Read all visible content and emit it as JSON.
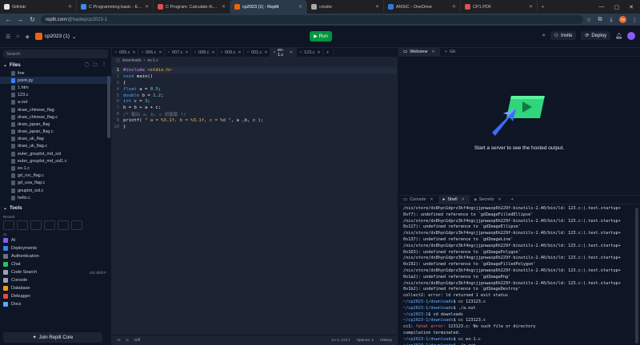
{
  "browser": {
    "tabs": [
      {
        "label": "GitHub",
        "color": "#e6e6e6",
        "active": false
      },
      {
        "label": "C Programming basic - Exerc",
        "color": "#4285f4",
        "active": false
      },
      {
        "label": "C Program: Calculate the sur",
        "color": "#d9534f",
        "active": false
      },
      {
        "label": "cp2023 (1) - Replit",
        "color": "#f26207",
        "active": true
      },
      {
        "label": "cmsite",
        "color": "#aaaaaa",
        "active": false
      },
      {
        "label": "ANSIC - OneDrive",
        "color": "#2c7cd1",
        "active": false
      },
      {
        "label": "CP1.PDF",
        "color": "#d9534f",
        "active": false
      }
    ],
    "url_host": "replit.com",
    "url_path": "/@hadoq/cp2023-1",
    "profile_initials": "hs"
  },
  "app": {
    "repl_name": "cp2023 (1)",
    "run_label": "Run",
    "invite_label": "Invite",
    "deploy_label": "Deploy"
  },
  "sidebar": {
    "search_placeholder": "Search",
    "files_title": "Files",
    "files": [
      {
        "name": "line",
        "kind": "file"
      },
      {
        "name": "point.py",
        "kind": "py"
      },
      {
        "name": "1.htm",
        "kind": "file"
      },
      {
        "name": "123.c",
        "kind": "file"
      },
      {
        "name": "a.out",
        "kind": "file"
      },
      {
        "name": "draw_chinese_flag",
        "kind": "file"
      },
      {
        "name": "draw_chinese_flag.c",
        "kind": "file"
      },
      {
        "name": "draw_japan_flag",
        "kind": "file"
      },
      {
        "name": "draw_japan_flag.c",
        "kind": "file"
      },
      {
        "name": "draw_uk_flag",
        "kind": "file"
      },
      {
        "name": "draw_uk_flag.c",
        "kind": "file"
      },
      {
        "name": "euler_gnuplot_md_sol",
        "kind": "file"
      },
      {
        "name": "euler_gnuplot_md_sol1.c",
        "kind": "file"
      },
      {
        "name": "ex-1.c",
        "kind": "file"
      },
      {
        "name": "gd_roc_flag.c",
        "kind": "file"
      },
      {
        "name": "gd_usa_flag.c",
        "kind": "file"
      },
      {
        "name": "gnuplot_sol.c",
        "kind": "file"
      },
      {
        "name": "hello.c",
        "kind": "file"
      }
    ],
    "tools_title": "Tools",
    "recent_label": "Recent",
    "ai_label": "AI",
    "tools": [
      {
        "name": "AI",
        "color": "#8a5cf6",
        "shortcut": ""
      },
      {
        "name": "Deployments",
        "color": "#3b82f6",
        "shortcut": ""
      },
      {
        "name": "Authentication",
        "color": "#6b7280",
        "shortcut": ""
      },
      {
        "name": "Chat",
        "color": "#22c55e",
        "shortcut": ""
      },
      {
        "name": "Code Search",
        "color": "#9ca3af",
        "shortcut": "Ctrl Shift F"
      },
      {
        "name": "Console",
        "color": "#9ca3af",
        "shortcut": ""
      },
      {
        "name": "Database",
        "color": "#f59e0b",
        "shortcut": ""
      },
      {
        "name": "Debugger",
        "color": "#ef4444",
        "shortcut": ""
      },
      {
        "name": "Docs",
        "color": "#60a5fa",
        "shortcut": ""
      }
    ],
    "join_core_label": "Join Replit Core"
  },
  "editor": {
    "tabs": [
      {
        "label": "005.c",
        "active": false
      },
      {
        "label": "006.c",
        "active": false
      },
      {
        "label": "007.c",
        "active": false
      },
      {
        "label": "008.c",
        "active": false
      },
      {
        "label": "009.c",
        "active": false
      },
      {
        "label": "001.c",
        "active": false
      },
      {
        "label": "ex-1.c",
        "active": true
      },
      {
        "label": "123.c",
        "active": false
      }
    ],
    "breadcrumb_folder": "downloads",
    "breadcrumb_file": "ex-1.c",
    "code_lines": [
      [
        {
          "t": "#include ",
          "c": "pp"
        },
        {
          "t": "<stdio.h>",
          "c": "st"
        }
      ],
      [
        {
          "t": "void ",
          "c": "ty"
        },
        {
          "t": "main",
          "c": "id"
        },
        {
          "t": "()",
          "c": "id"
        }
      ],
      [
        {
          "t": "{",
          "c": "id"
        }
      ],
      [
        {
          "t": "float ",
          "c": "ty"
        },
        {
          "t": "a = ",
          "c": "id"
        },
        {
          "t": "0.5",
          "c": "nm"
        },
        {
          "t": ";",
          "c": "id"
        }
      ],
      [
        {
          "t": "double ",
          "c": "ty"
        },
        {
          "t": "b = ",
          "c": "id"
        },
        {
          "t": "1.2",
          "c": "nm"
        },
        {
          "t": ";",
          "c": "id"
        }
      ],
      [
        {
          "t": "int ",
          "c": "ty"
        },
        {
          "t": "c = ",
          "c": "id"
        },
        {
          "t": "3",
          "c": "nm"
        },
        {
          "t": ";",
          "c": "id"
        }
      ],
      [
        {
          "t": "b = b + a + c;",
          "c": "id"
        }
      ],
      [
        {
          "t": "/* 輸出 a, b, c 到螢幕 */",
          "c": "cm"
        }
      ],
      [
        {
          "t": "printf",
          "c": "id"
        },
        {
          "t": "( ",
          "c": "id"
        },
        {
          "t": "\" a = %3.1f, b = %3.1f, c = %d \"",
          "c": "st"
        },
        {
          "t": ", a ,b, c );",
          "c": "id"
        }
      ],
      [
        {
          "t": "}",
          "c": "id"
        }
      ]
    ],
    "status_ai": "AI",
    "status_lang": "C",
    "status_diff": "Diff",
    "status_position": "Ln 1, Col 1",
    "status_spaces": "Spaces: 2",
    "status_history": "History"
  },
  "webview": {
    "tab_label": "Webview",
    "git_tab_label": "Git",
    "message": "Start a server to see the hosted output."
  },
  "console": {
    "tabs": [
      {
        "label": "Console",
        "active": false
      },
      {
        "label": "Shell",
        "active": true
      },
      {
        "label": "Secrets",
        "active": false
      }
    ],
    "lines": [
      [
        {
          "t": "/nix/store/dx8hyn1dprz3kf4ngcjjpnwaxp6h229f-binutils-2.40/bin/ld: 123.c:(.text.startup+",
          "c": ""
        }
      ],
      [
        {
          "t": "0xf7): undefined reference to `gdImageFilledEllipse'",
          "c": ""
        }
      ],
      [
        {
          "t": "/nix/store/dx8hyn1dprz3kf4ngcjjpnwaxp6h229f-binutils-2.40/bin/ld: 123.c:(.text.startup+",
          "c": ""
        }
      ],
      [
        {
          "t": "0x117): undefined reference to `gdImageEllipse'",
          "c": ""
        }
      ],
      [
        {
          "t": "/nix/store/dx8hyn1dprz3kf4ngcjjpnwaxp6h229f-binutils-2.40/bin/ld: 123.c:(.text.startup+",
          "c": ""
        }
      ],
      [
        {
          "t": "0x137): undefined reference to `gdImageLine'",
          "c": ""
        }
      ],
      [
        {
          "t": "/nix/store/dx8hyn1dprz3kf4ngcjjpnwaxp6h229f-binutils-2.40/bin/ld: 123.c:(.text.startup+",
          "c": ""
        }
      ],
      [
        {
          "t": "0x163): undefined reference to `gdImagePolygon'",
          "c": ""
        }
      ],
      [
        {
          "t": "/nix/store/dx8hyn1dprz3kf4ngcjjpnwaxp6h229f-binutils-2.40/bin/ld: 123.c:(.text.startup+",
          "c": ""
        }
      ],
      [
        {
          "t": "0x192): undefined reference to `gdImageFilledPolygon'",
          "c": ""
        }
      ],
      [
        {
          "t": "/nix/store/dx8hyn1dprz3kf4ngcjjpnwaxp6h229f-binutils-2.40/bin/ld: 123.c:(.text.startup+",
          "c": ""
        }
      ],
      [
        {
          "t": "0x1a2): undefined reference to `gdImagePng'",
          "c": ""
        }
      ],
      [
        {
          "t": "/nix/store/dx8hyn1dprz3kf4ngcjjpnwaxp6h229f-binutils-2.40/bin/ld: 123.c:(.text.startup+",
          "c": ""
        }
      ],
      [
        {
          "t": "0x1b2): undefined reference to `gdImageDestroy'",
          "c": ""
        }
      ],
      [
        {
          "t": "collect2: error: ld returned 1 exit status",
          "c": ""
        }
      ],
      [
        {
          "t": "~/cp2023-1/downloads",
          "c": "b"
        },
        {
          "t": "$ cc 123123.c",
          "c": ""
        }
      ],
      [
        {
          "t": "~/cp2023-1/downloads",
          "c": "b"
        },
        {
          "t": "$ ./a.out",
          "c": ""
        }
      ],
      [
        {
          "t": "~/cp2023-1",
          "c": "b"
        },
        {
          "t": "$ cd downloads",
          "c": ""
        }
      ],
      [
        {
          "t": "~/cp2023-1/downloads",
          "c": "b"
        },
        {
          "t": "$ cc 123123.c",
          "c": ""
        }
      ],
      [
        {
          "t": "cc1: ",
          "c": ""
        },
        {
          "t": "fatal error: ",
          "c": "r"
        },
        {
          "t": "123123.c: No such file or directory",
          "c": ""
        }
      ],
      [
        {
          "t": "compilation terminated.",
          "c": ""
        }
      ],
      [
        {
          "t": "~/cp2023-1/downloads",
          "c": "b"
        },
        {
          "t": "$ cc ex-1.c",
          "c": ""
        }
      ],
      [
        {
          "t": "~/cp2023-1/downloads",
          "c": "b"
        },
        {
          "t": "$ ./a.out",
          "c": ""
        }
      ],
      [
        {
          "t": " a = 0.5, b = 4.7, c = 3 ",
          "c": ""
        },
        {
          "t": "~/cp2023-1/downloads",
          "c": "b"
        },
        {
          "t": "$ ",
          "c": ""
        }
      ]
    ]
  }
}
